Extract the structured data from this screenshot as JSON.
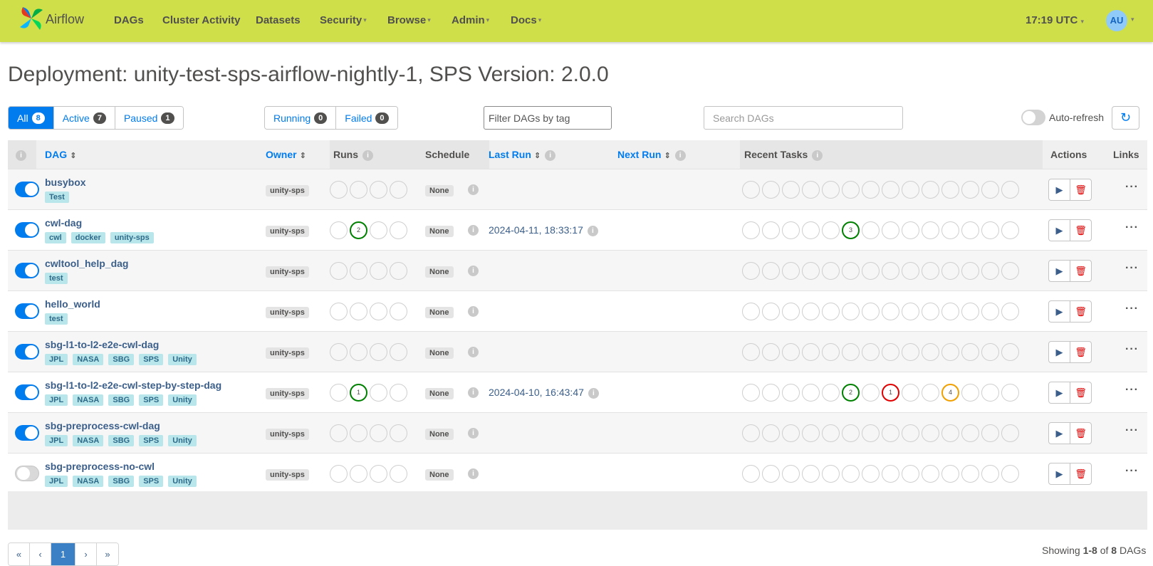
{
  "navbar": {
    "brand": "Airflow",
    "items": [
      {
        "label": "DAGs",
        "dropdown": false
      },
      {
        "label": "Cluster Activity",
        "dropdown": false
      },
      {
        "label": "Datasets",
        "dropdown": false
      },
      {
        "label": "Security",
        "dropdown": true
      },
      {
        "label": "Browse",
        "dropdown": true
      },
      {
        "label": "Admin",
        "dropdown": true
      },
      {
        "label": "Docs",
        "dropdown": true
      }
    ],
    "clock": "17:19 UTC",
    "user_initials": "AU"
  },
  "page_title": "Deployment: unity-test-sps-airflow-nightly-1, SPS Version: 2.0.0",
  "status_filters": [
    {
      "label": "All",
      "count": "8"
    },
    {
      "label": "Active",
      "count": "7"
    },
    {
      "label": "Paused",
      "count": "1"
    }
  ],
  "run_filters": [
    {
      "label": "Running",
      "count": "0"
    },
    {
      "label": "Failed",
      "count": "0"
    }
  ],
  "tag_filter_placeholder": "Filter DAGs by tag",
  "search_placeholder": "Search DAGs",
  "autorefresh_label": "Auto-refresh",
  "columns": {
    "dag": "DAG",
    "owner": "Owner",
    "runs": "Runs",
    "schedule": "Schedule",
    "last_run": "Last Run",
    "next_run": "Next Run",
    "recent_tasks": "Recent Tasks",
    "actions": "Actions",
    "links": "Links"
  },
  "dags": [
    {
      "name": "busybox",
      "tags": [
        "Test"
      ],
      "owner": "unity-sps",
      "active": true,
      "schedule": "None",
      "last_run": "",
      "runs": [
        "",
        "",
        "",
        ""
      ],
      "tasks": [
        "",
        "",
        "",
        "",
        "",
        "",
        "",
        "",
        "",
        "",
        "",
        "",
        "",
        ""
      ]
    },
    {
      "name": "cwl-dag",
      "tags": [
        "cwl",
        "docker",
        "unity-sps"
      ],
      "owner": "unity-sps",
      "active": true,
      "schedule": "None",
      "last_run": "2024-04-11, 18:33:17",
      "runs": [
        "",
        "success:2",
        "",
        ""
      ],
      "tasks": [
        "",
        "",
        "",
        "",
        "",
        "success:3",
        "",
        "",
        "",
        "",
        "",
        "",
        "",
        ""
      ]
    },
    {
      "name": "cwltool_help_dag",
      "tags": [
        "test"
      ],
      "owner": "unity-sps",
      "active": true,
      "schedule": "None",
      "last_run": "",
      "runs": [
        "",
        "",
        "",
        ""
      ],
      "tasks": [
        "",
        "",
        "",
        "",
        "",
        "",
        "",
        "",
        "",
        "",
        "",
        "",
        "",
        ""
      ]
    },
    {
      "name": "hello_world",
      "tags": [
        "test"
      ],
      "owner": "unity-sps",
      "active": true,
      "schedule": "None",
      "last_run": "",
      "runs": [
        "",
        "",
        "",
        ""
      ],
      "tasks": [
        "",
        "",
        "",
        "",
        "",
        "",
        "",
        "",
        "",
        "",
        "",
        "",
        "",
        ""
      ]
    },
    {
      "name": "sbg-l1-to-l2-e2e-cwl-dag",
      "tags": [
        "JPL",
        "NASA",
        "SBG",
        "SPS",
        "Unity"
      ],
      "owner": "unity-sps",
      "active": true,
      "schedule": "None",
      "last_run": "",
      "runs": [
        "",
        "",
        "",
        ""
      ],
      "tasks": [
        "",
        "",
        "",
        "",
        "",
        "",
        "",
        "",
        "",
        "",
        "",
        "",
        "",
        ""
      ]
    },
    {
      "name": "sbg-l1-to-l2-e2e-cwl-step-by-step-dag",
      "tags": [
        "JPL",
        "NASA",
        "SBG",
        "SPS",
        "Unity"
      ],
      "owner": "unity-sps",
      "active": true,
      "schedule": "None",
      "last_run": "2024-04-10, 16:43:47",
      "runs": [
        "",
        "success:1",
        "",
        ""
      ],
      "tasks": [
        "",
        "",
        "",
        "",
        "",
        "success:2",
        "",
        "failed:1",
        "",
        "",
        "upstream:4",
        "",
        "",
        ""
      ]
    },
    {
      "name": "sbg-preprocess-cwl-dag",
      "tags": [
        "JPL",
        "NASA",
        "SBG",
        "SPS",
        "Unity"
      ],
      "owner": "unity-sps",
      "active": true,
      "schedule": "None",
      "last_run": "",
      "runs": [
        "",
        "",
        "",
        ""
      ],
      "tasks": [
        "",
        "",
        "",
        "",
        "",
        "",
        "",
        "",
        "",
        "",
        "",
        "",
        "",
        ""
      ]
    },
    {
      "name": "sbg-preprocess-no-cwl",
      "tags": [
        "JPL",
        "NASA",
        "SBG",
        "SPS",
        "Unity"
      ],
      "owner": "unity-sps",
      "active": false,
      "schedule": "None",
      "last_run": "",
      "runs": [
        "",
        "",
        "",
        ""
      ],
      "tasks": [
        "",
        "",
        "",
        "",
        "",
        "",
        "",
        "",
        "",
        "",
        "",
        "",
        "",
        ""
      ]
    }
  ],
  "pagination": {
    "first": "«",
    "prev": "‹",
    "current": "1",
    "next": "›",
    "last": "»"
  },
  "showing": {
    "prefix": "Showing ",
    "range": "1-8",
    "mid": " of ",
    "total": "8",
    "suffix": " DAGs"
  }
}
